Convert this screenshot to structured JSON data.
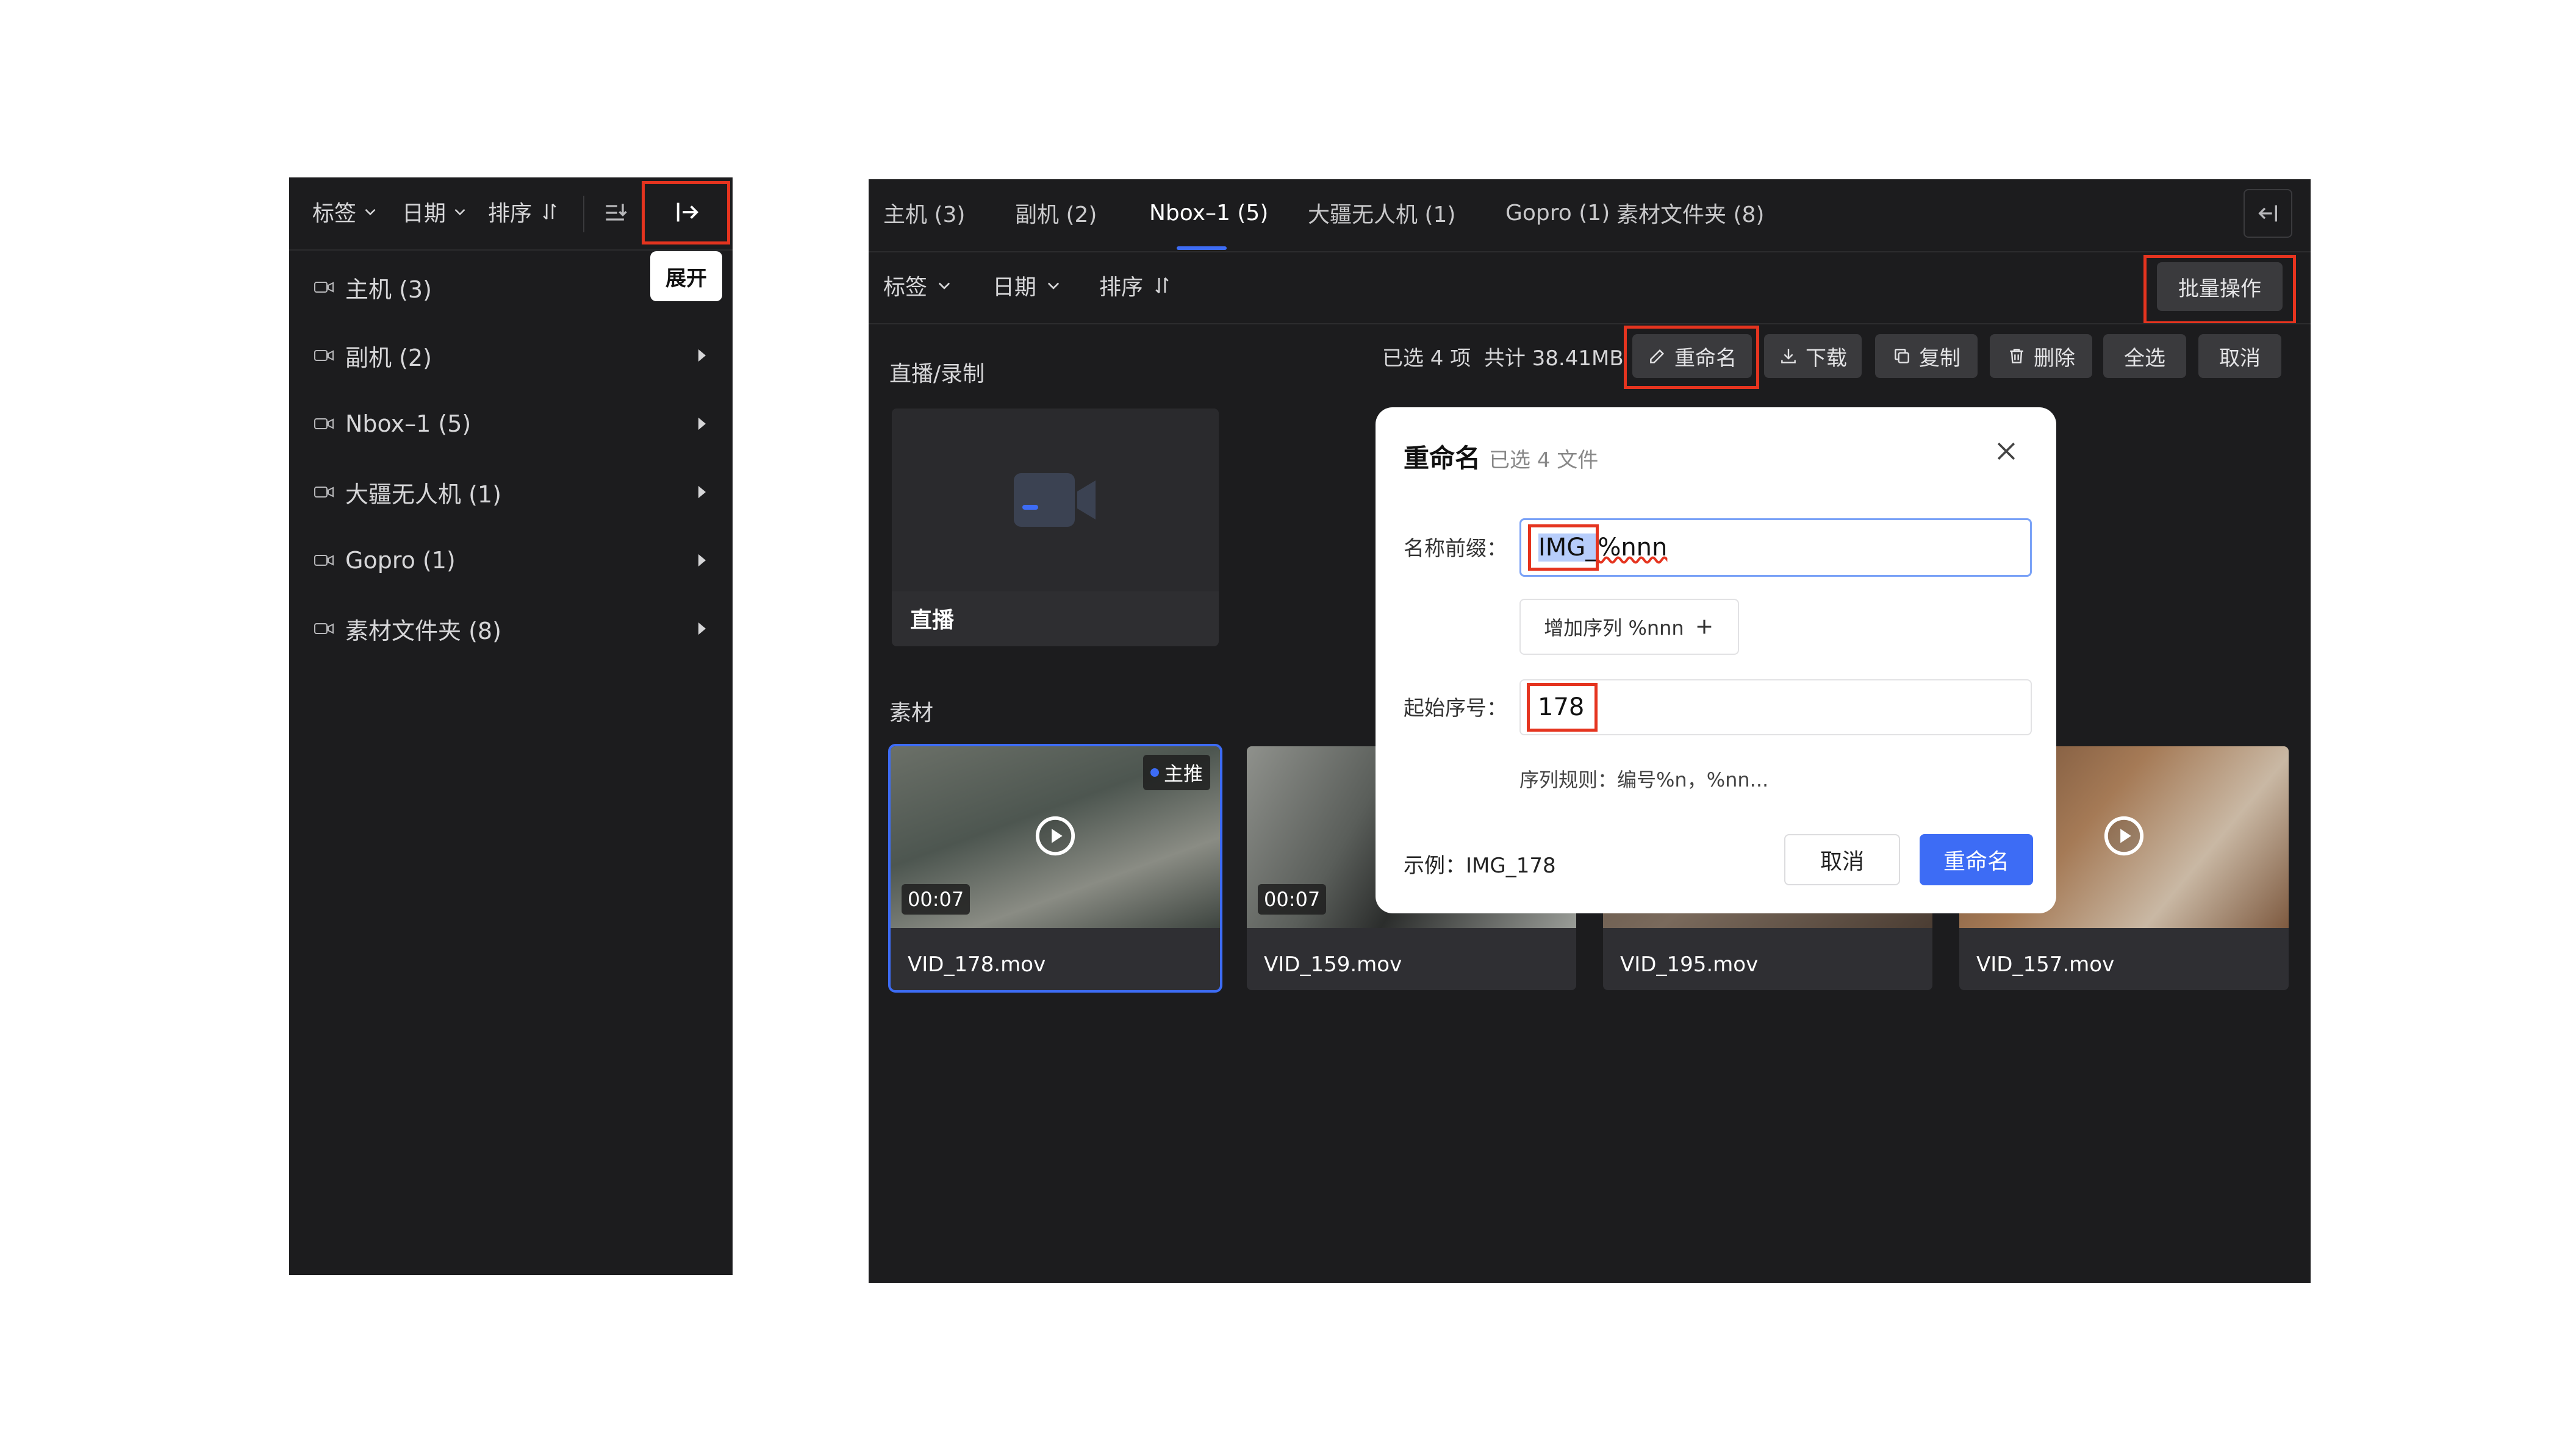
{
  "left_panel": {
    "toolbar": {
      "tag_label": "标签",
      "date_label": "日期",
      "sort_label": "排序"
    },
    "tooltip": "展开",
    "items": [
      {
        "label": "主机 (3)",
        "has_arrow": false
      },
      {
        "label": "副机 (2)",
        "has_arrow": true
      },
      {
        "label": "Nbox–1 (5)",
        "has_arrow": true
      },
      {
        "label": "大疆无人机 (1)",
        "has_arrow": true
      },
      {
        "label": "Gopro (1)",
        "has_arrow": true
      },
      {
        "label": "素材文件夹 (8)",
        "has_arrow": true
      }
    ]
  },
  "main_panel": {
    "tabs": [
      {
        "label": "主机 (3)"
      },
      {
        "label": "副机 (2)"
      },
      {
        "label": "Nbox–1 (5)",
        "active": true
      },
      {
        "label": "大疆无人机 (1)"
      },
      {
        "label": "Gopro (1)"
      },
      {
        "label": "素材文件夹 (8)"
      }
    ],
    "filters": {
      "tag_label": "标签",
      "date_label": "日期",
      "sort_label": "排序",
      "batch_label": "批量操作"
    },
    "selection": {
      "summary": "已选 4 项  共计 38.41MB",
      "rename": "重命名",
      "download": "下载",
      "copy": "复制",
      "delete": "删除",
      "select_all": "全选",
      "cancel": "取消"
    },
    "live_section": {
      "title": "直播/录制",
      "card_label": "直播"
    },
    "media_section": {
      "title": "素材",
      "badge": "主推",
      "items": [
        {
          "name": "VID_178.mov",
          "duration": "00:07"
        },
        {
          "name": "VID_159.mov",
          "duration": "00:07"
        },
        {
          "name": "VID_195.mov",
          "duration": ""
        },
        {
          "name": "VID_157.mov",
          "duration": ""
        }
      ]
    }
  },
  "dialog": {
    "title": "重命名",
    "subtitle": "已选 4 文件",
    "prefix_label": "名称前缀：",
    "prefix_selected": "IMG_",
    "prefix_rest": "%nnn",
    "add_seq_label": "增加序列 %nnn",
    "start_label": "起始序号：",
    "start_value": "178",
    "rule_text": "序列规则：编号%n，%nn...",
    "example_text": "示例：IMG_178",
    "cancel_label": "取消",
    "confirm_label": "重命名"
  },
  "colors": {
    "accent": "#3d6cf5",
    "highlight": "#e5341f",
    "panel_bg": "#1c1c1e"
  }
}
